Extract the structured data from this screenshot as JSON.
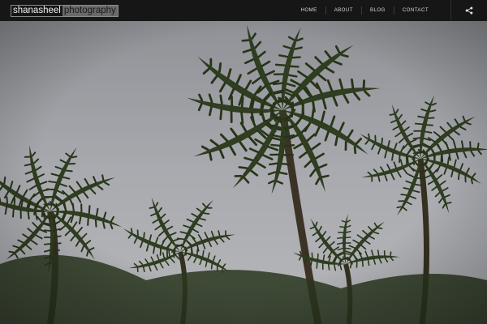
{
  "site": {
    "logo_part1": "shanasheel",
    "logo_part2": "photography"
  },
  "nav": {
    "items": [
      {
        "label": "HOME"
      },
      {
        "label": "ABOUT"
      },
      {
        "label": "BLOG"
      },
      {
        "label": "CONTACT"
      }
    ],
    "share_icon": "share-icon"
  },
  "hero": {
    "image": "coconut palm trees against overcast sky",
    "colors": {
      "sky": "#a7a8ad",
      "frond": "#2b3a1e",
      "trunk": "#3c3326"
    }
  }
}
